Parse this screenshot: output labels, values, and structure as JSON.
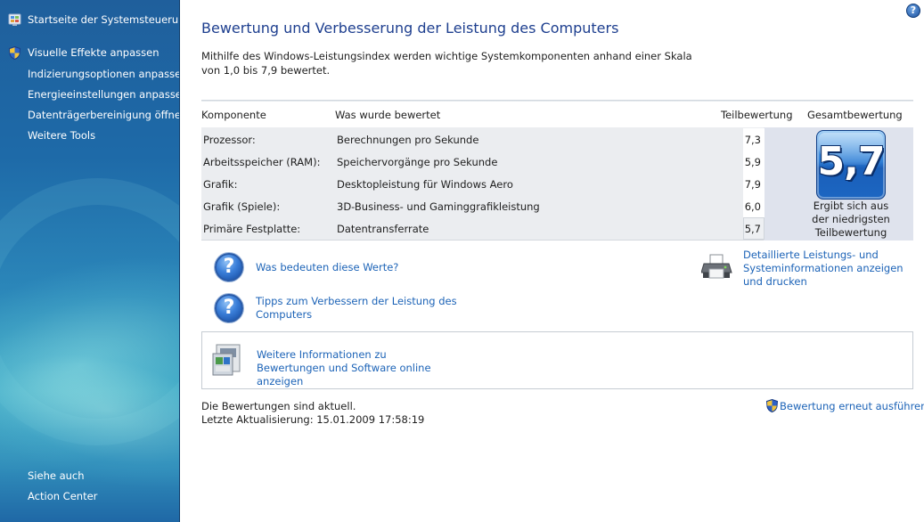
{
  "sidebar": {
    "home_link": "Startseite der Systemsteuerung",
    "tasks": [
      {
        "label": "Visuelle Effekte anpassen",
        "shield": true
      },
      {
        "label": "Indizierungsoptionen anpassen"
      },
      {
        "label": "Energieeinstellungen anpassen"
      },
      {
        "label": "Datenträgerbereinigung öffnen"
      },
      {
        "label": "Weitere Tools"
      }
    ],
    "see_also": {
      "heading": "Siehe auch",
      "items": [
        {
          "label": "Action Center"
        }
      ]
    }
  },
  "header": {
    "title": "Bewertung und Verbesserung der Leistung des Computers",
    "intro": "Mithilfe des Windows-Leistungsindex werden wichtige Systemkomponenten anhand einer Skala von 1,0 bis 7,9 bewertet.",
    "help_glyph": "?"
  },
  "table": {
    "headers": {
      "component": "Komponente",
      "rated": "Was wurde bewertet",
      "subscore": "Teilbewertung",
      "base_score": "Gesamtbewertung"
    },
    "rows": [
      {
        "component": "Prozessor:",
        "rated": "Berechnungen pro Sekunde",
        "subscore": "7,3"
      },
      {
        "component": "Arbeitsspeicher (RAM):",
        "rated": "Speichervorgänge pro Sekunde",
        "subscore": "5,9"
      },
      {
        "component": "Grafik:",
        "rated": "Desktopleistung für Windows Aero",
        "subscore": "7,9"
      },
      {
        "component": "Grafik (Spiele):",
        "rated": "3D-Business- und Gaminggrafikleistung",
        "subscore": "6,0"
      },
      {
        "component": "Primäre Festplatte:",
        "rated": "Datentransferrate",
        "subscore": "5,7"
      }
    ],
    "base_score": "5,7",
    "base_score_caption": "Ergibt sich aus der niedrigsten Teilbewertung"
  },
  "links": {
    "what_mean": "Was bedeuten diese Werte?",
    "tips": "Tipps zum Verbessern der Leistung des Computers",
    "details": "Detaillierte Leistungs- und Systeminformationen anzeigen und drucken",
    "online": "Weitere Informationen zu Bewertungen und Software online anzeigen"
  },
  "status": {
    "current": "Die Bewertungen sind aktuell.",
    "last_update": "Letzte Aktualisierung: 15.01.2009 17:58:19",
    "rerun": "Bewertung erneut ausführen"
  },
  "colors": {
    "title": "#1e3f8f",
    "link": "#1c63b7",
    "sidebar_top": "#1f5f9c",
    "table_bg": "#ebedf0"
  },
  "icons": {
    "home": "control-panel-icon",
    "shield": "uac-shield-icon",
    "help": "help-icon",
    "question": "question-icon",
    "printer": "printer-icon",
    "online": "software-box-icon"
  }
}
